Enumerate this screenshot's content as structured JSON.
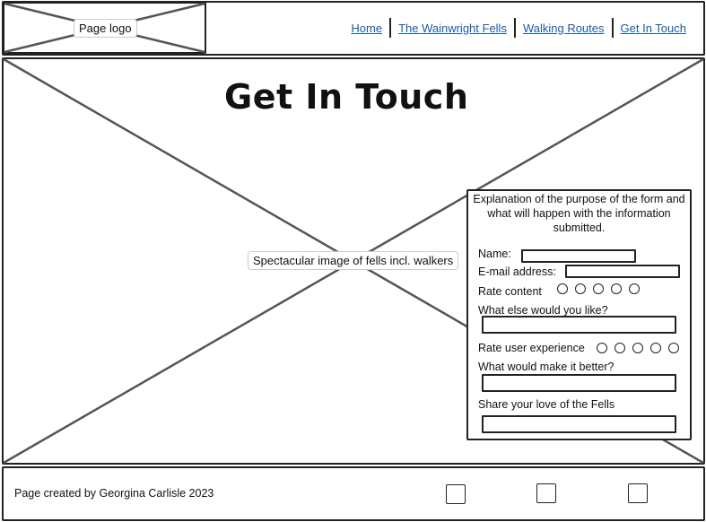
{
  "header": {
    "logo_label": "Page logo",
    "nav": [
      "Home",
      "The Wainwright Fells",
      "Walking Routes",
      "Get In Touch"
    ]
  },
  "hero": {
    "title": "Get In Touch",
    "image_label": "Spectacular image of fells incl. walkers"
  },
  "form": {
    "explanation": "Explanation of the purpose of the form and what will happen with the information submitted.",
    "name_label": "Name:",
    "email_label": "E-mail address:",
    "rate_content_label": "Rate content",
    "what_else_label": "What else would you like?",
    "rate_ux_label": "Rate user experience",
    "better_label": "What would make it better?",
    "share_label": "Share your love of the Fells",
    "rating_options": 5
  },
  "footer": {
    "credit": "Page created by Georgina Carlisle 2023",
    "social_icons": [
      "social-icon",
      "social-icon",
      "social-icon"
    ]
  }
}
